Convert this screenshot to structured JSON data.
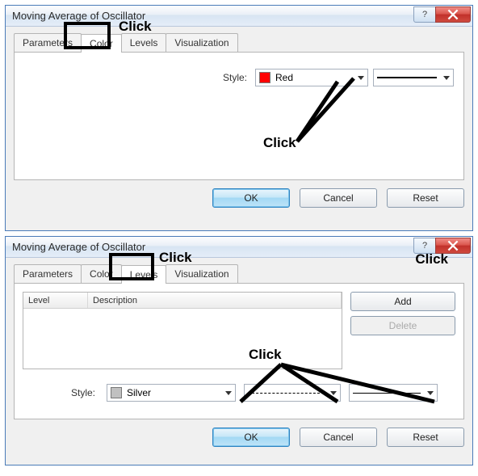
{
  "dialog1": {
    "title": "Moving Average of Oscillator",
    "tabs": {
      "parameters": "Parameters",
      "colors": "Color",
      "levels": "Levels",
      "visualization": "Visualization"
    },
    "style": {
      "label": "Style:",
      "color_name": "Red",
      "color_hex": "#ff0000"
    },
    "buttons": {
      "ok": "OK",
      "cancel": "Cancel",
      "reset": "Reset"
    },
    "anno": {
      "click_tab": "Click",
      "click_combo": "Click"
    }
  },
  "dialog2": {
    "title": "Moving Average of Oscillator",
    "tabs": {
      "parameters": "Parameters",
      "colors": "Color",
      "levels": "Levels",
      "visualization": "Visualization"
    },
    "list": {
      "col_level": "Level",
      "col_desc": "Description"
    },
    "side": {
      "add": "Add",
      "delete": "Delete"
    },
    "style": {
      "label": "Style:",
      "color_name": "Silver",
      "color_hex": "#c0c0c0"
    },
    "buttons": {
      "ok": "OK",
      "cancel": "Cancel",
      "reset": "Reset"
    },
    "anno": {
      "click_tab": "Click",
      "click_add": "Click",
      "click_combo": "Click"
    }
  }
}
